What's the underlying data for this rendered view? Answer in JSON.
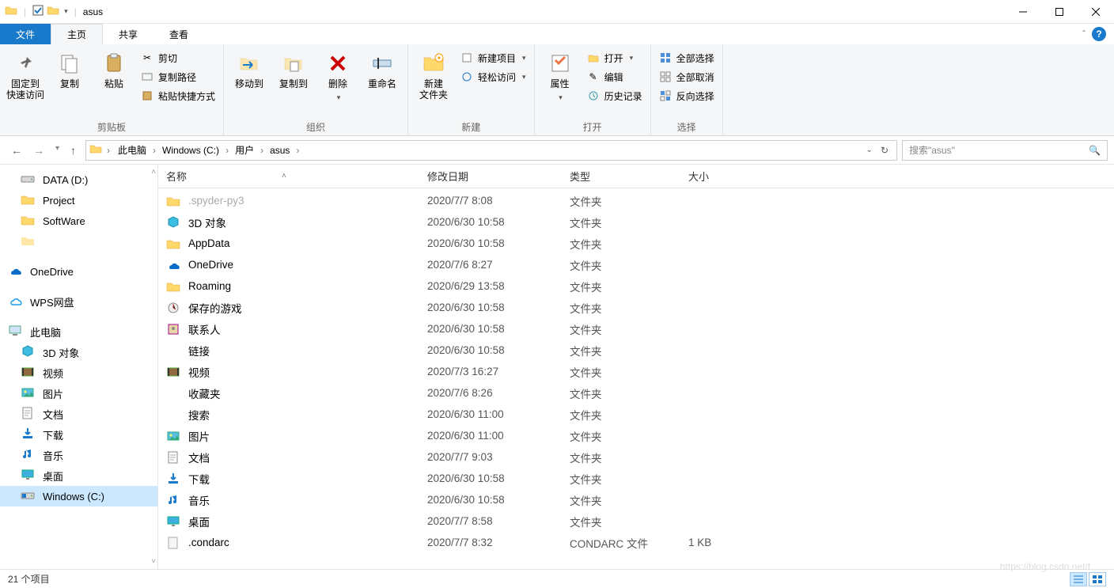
{
  "title": "asus",
  "tabs": {
    "file": "文件",
    "home": "主页",
    "share": "共享",
    "view": "查看"
  },
  "ribbon": {
    "clipboard": {
      "pin": "固定到\n快速访问",
      "copy": "复制",
      "paste": "粘贴",
      "cut": "剪切",
      "copypath": "复制路径",
      "pasteshortcut": "粘贴快捷方式",
      "label": "剪贴板"
    },
    "organize": {
      "moveto": "移动到",
      "copyto": "复制到",
      "delete": "删除",
      "rename": "重命名",
      "label": "组织"
    },
    "new": {
      "newfolder": "新建\n文件夹",
      "newitem": "新建项目",
      "easyaccess": "轻松访问",
      "label": "新建"
    },
    "open": {
      "properties": "属性",
      "open": "打开",
      "edit": "编辑",
      "history": "历史记录",
      "label": "打开"
    },
    "select": {
      "all": "全部选择",
      "none": "全部取消",
      "invert": "反向选择",
      "label": "选择"
    }
  },
  "breadcrumb": [
    "此电脑",
    "Windows (C:)",
    "用户",
    "asus"
  ],
  "search_placeholder": "搜索\"asus\"",
  "columns": {
    "name": "名称",
    "date": "修改日期",
    "type": "类型",
    "size": "大小"
  },
  "sidebar": [
    {
      "icon": "drive",
      "label": "DATA (D:)",
      "depth": 1
    },
    {
      "icon": "folder",
      "label": "Project",
      "depth": 1
    },
    {
      "icon": "folder",
      "label": "SoftWare",
      "depth": 1
    },
    {
      "icon": "folder-blur",
      "label": "",
      "depth": 1
    },
    {
      "spacer": true
    },
    {
      "icon": "onedrive",
      "label": "OneDrive",
      "depth": 0
    },
    {
      "spacer": true
    },
    {
      "icon": "wps",
      "label": "WPS网盘",
      "depth": 0
    },
    {
      "spacer": true
    },
    {
      "icon": "pc",
      "label": "此电脑",
      "depth": 0
    },
    {
      "icon": "3d",
      "label": "3D 对象",
      "depth": 1
    },
    {
      "icon": "video",
      "label": "视频",
      "depth": 1
    },
    {
      "icon": "pictures",
      "label": "图片",
      "depth": 1
    },
    {
      "icon": "documents",
      "label": "文档",
      "depth": 1
    },
    {
      "icon": "downloads",
      "label": "下载",
      "depth": 1
    },
    {
      "icon": "music",
      "label": "音乐",
      "depth": 1
    },
    {
      "icon": "desktop",
      "label": "桌面",
      "depth": 1
    },
    {
      "icon": "drive-win",
      "label": "Windows (C:)",
      "depth": 1,
      "selected": true
    }
  ],
  "files": [
    {
      "icon": "folder",
      "name": ".spyder-py3",
      "date": "2020/7/7 8:08",
      "type": "文件夹",
      "size": "",
      "cut": true
    },
    {
      "icon": "3d",
      "name": "3D 对象",
      "date": "2020/6/30 10:58",
      "type": "文件夹",
      "size": ""
    },
    {
      "icon": "folder",
      "name": "AppData",
      "date": "2020/6/30 10:58",
      "type": "文件夹",
      "size": ""
    },
    {
      "icon": "onedrive",
      "name": "OneDrive",
      "date": "2020/7/6 8:27",
      "type": "文件夹",
      "size": ""
    },
    {
      "icon": "folder",
      "name": "Roaming",
      "date": "2020/6/29 13:58",
      "type": "文件夹",
      "size": ""
    },
    {
      "icon": "games",
      "name": "保存的游戏",
      "date": "2020/6/30 10:58",
      "type": "文件夹",
      "size": ""
    },
    {
      "icon": "contacts",
      "name": "联系人",
      "date": "2020/6/30 10:58",
      "type": "文件夹",
      "size": ""
    },
    {
      "icon": "links",
      "name": "链接",
      "date": "2020/6/30 10:58",
      "type": "文件夹",
      "size": ""
    },
    {
      "icon": "video",
      "name": "视频",
      "date": "2020/7/3 16:27",
      "type": "文件夹",
      "size": ""
    },
    {
      "icon": "favorites",
      "name": "收藏夹",
      "date": "2020/7/6 8:26",
      "type": "文件夹",
      "size": ""
    },
    {
      "icon": "search",
      "name": "搜索",
      "date": "2020/6/30 11:00",
      "type": "文件夹",
      "size": ""
    },
    {
      "icon": "pictures",
      "name": "图片",
      "date": "2020/6/30 11:00",
      "type": "文件夹",
      "size": ""
    },
    {
      "icon": "documents",
      "name": "文档",
      "date": "2020/7/7 9:03",
      "type": "文件夹",
      "size": ""
    },
    {
      "icon": "downloads",
      "name": "下载",
      "date": "2020/6/30 10:58",
      "type": "文件夹",
      "size": ""
    },
    {
      "icon": "music",
      "name": "音乐",
      "date": "2020/6/30 10:58",
      "type": "文件夹",
      "size": ""
    },
    {
      "icon": "desktop",
      "name": "桌面",
      "date": "2020/7/7 8:58",
      "type": "文件夹",
      "size": ""
    },
    {
      "icon": "file",
      "name": ".condarc",
      "date": "2020/7/7 8:32",
      "type": "CONDARC 文件",
      "size": "1 KB"
    }
  ],
  "status": "21 个项目",
  "watermark": "https://blog.csdn.net/f"
}
